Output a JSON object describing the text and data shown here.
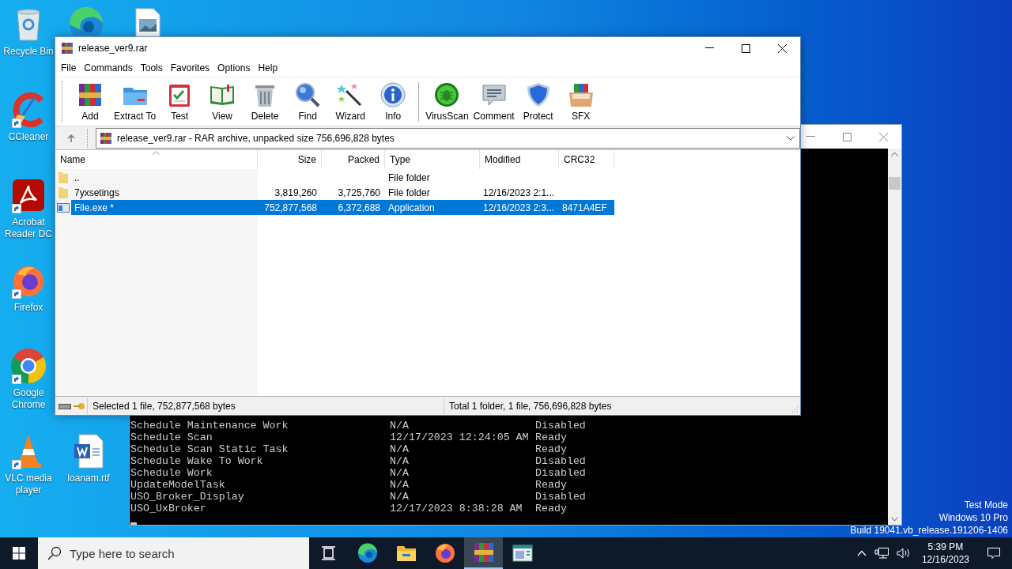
{
  "desktop_icons": [
    {
      "label": "Recycle Bin",
      "kind": "recycle",
      "shortcut": false
    },
    {
      "label": "CCleaner",
      "kind": "ccleaner",
      "shortcut": true
    },
    {
      "label": "Acrobat Reader DC",
      "kind": "acrobat",
      "shortcut": true
    },
    {
      "label": "Firefox",
      "kind": "firefox",
      "shortcut": true
    },
    {
      "label": "Google Chrome",
      "kind": "chrome",
      "shortcut": true
    },
    {
      "label": "VLC media player",
      "kind": "vlc",
      "shortcut": true
    }
  ],
  "desktop_files": [
    {
      "label": "loanam.rtf",
      "kind": "word",
      "shortcut": false
    }
  ],
  "console": {
    "lines": [
      {
        "column_1": "Schedule Maintenance Work",
        "column_2": "N/A",
        "column_3": "Disabled"
      },
      {
        "column_1": "Schedule Scan",
        "column_2": "12/17/2023 12:24:05 AM",
        "column_3": "Ready"
      },
      {
        "column_1": "Schedule Scan Static Task",
        "column_2": "N/A",
        "column_3": "Ready"
      },
      {
        "column_1": "Schedule Wake To Work",
        "column_2": "N/A",
        "column_3": "Disabled"
      },
      {
        "column_1": "Schedule Work",
        "column_2": "N/A",
        "column_3": "Disabled"
      },
      {
        "column_1": "UpdateModelTask",
        "column_2": "N/A",
        "column_3": "Ready"
      },
      {
        "column_1": "USO_Broker_Display",
        "column_2": "N/A",
        "column_3": "Disabled"
      },
      {
        "column_1": "USO_UxBroker",
        "column_2": "12/17/2023 8:38:28 AM",
        "column_3": "Ready"
      }
    ]
  },
  "winrar": {
    "title": "release_ver9.rar",
    "menu": [
      "File",
      "Commands",
      "Tools",
      "Favorites",
      "Options",
      "Help"
    ],
    "toolbar": [
      {
        "label": "Add",
        "kind": "add"
      },
      {
        "label": "Extract To",
        "kind": "extract"
      },
      {
        "label": "Test",
        "kind": "test"
      },
      {
        "label": "View",
        "kind": "view"
      },
      {
        "label": "Delete",
        "kind": "delete"
      },
      {
        "label": "Find",
        "kind": "find"
      },
      {
        "label": "Wizard",
        "kind": "wizard"
      },
      {
        "label": "Info",
        "kind": "info"
      },
      {
        "label": "VirusScan",
        "kind": "virusscan"
      },
      {
        "label": "Comment",
        "kind": "comment"
      },
      {
        "label": "Protect",
        "kind": "protect"
      },
      {
        "label": "SFX",
        "kind": "sfx"
      }
    ],
    "address": "release_ver9.rar - RAR archive, unpacked size 756,696,828 bytes",
    "columns": [
      {
        "label": "Name",
        "sorted": true
      },
      {
        "label": "Size",
        "sorted": false
      },
      {
        "label": "Packed",
        "sorted": false
      },
      {
        "label": "Type",
        "sorted": false
      },
      {
        "label": "Modified",
        "sorted": false
      },
      {
        "label": "CRC32",
        "sorted": false
      }
    ],
    "rows": [
      {
        "kind": "folder",
        "selected": false,
        "name": "..",
        "type": "File folder"
      },
      {
        "kind": "folder",
        "selected": false,
        "name": "7yxsetings",
        "size": "3,819,260",
        "packed": "3,725,760",
        "type": "File folder",
        "modified": "12/16/2023 2:1..."
      },
      {
        "kind": "application",
        "selected": true,
        "name": "File.exe *",
        "size": "752,877,568",
        "packed": "6,372,688",
        "type": "Application",
        "modified": "12/16/2023 2:3...",
        "crc32": "8471A4EF"
      }
    ],
    "status_left": "Selected 1 file, 752,877,568 bytes",
    "status_right": "Total 1 folder, 1 file, 756,696,828 bytes"
  },
  "system_watermark": [
    "Test Mode",
    "Windows 10 Pro",
    "Build 19041.vb_release.191206-1406"
  ],
  "taskbar": {
    "search": {
      "placeholder": "Type here to search"
    },
    "apps": [
      {
        "kind": "taskview",
        "selected": false
      },
      {
        "kind": "edge",
        "selected": false
      },
      {
        "kind": "explorer",
        "selected": false
      },
      {
        "kind": "firefox",
        "selected": false
      },
      {
        "kind": "winrar",
        "selected": true
      },
      {
        "kind": "window",
        "selected": false
      }
    ],
    "time": "5:39 PM",
    "date": "12/16/2023"
  }
}
